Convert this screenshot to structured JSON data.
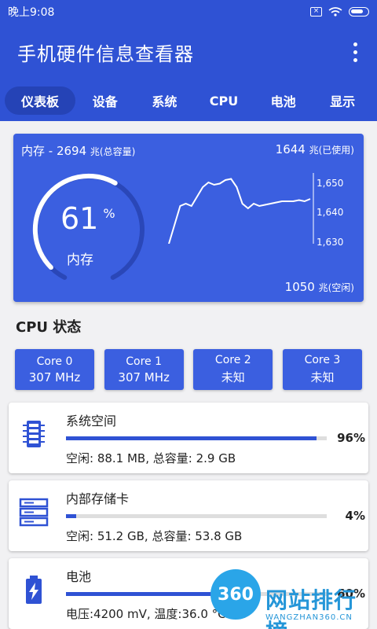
{
  "status_bar": {
    "time": "晚上9:08"
  },
  "app_bar": {
    "title": "手机硬件信息查看器"
  },
  "tabs": [
    {
      "label": "仪表板",
      "active": true
    },
    {
      "label": "设备"
    },
    {
      "label": "系统"
    },
    {
      "label": "CPU"
    },
    {
      "label": "电池"
    },
    {
      "label": "显示"
    }
  ],
  "memory": {
    "total_label": "内存 - 2694",
    "total_unit": "兆(总容量)",
    "used_value": "1644",
    "used_unit": "兆(已使用)",
    "free_value": "1050",
    "free_unit": "兆(空闲)",
    "gauge_percent": "61",
    "gauge_percent_sign": "%",
    "gauge_label": "内存",
    "gauge_fraction": 0.61
  },
  "chart_data": {
    "type": "line",
    "y_ticks": [
      "1,650",
      "1,640",
      "1,630"
    ],
    "ylim": [
      1625,
      1655
    ],
    "values": [
      1625,
      1633,
      1641,
      1642,
      1641,
      1645,
      1649,
      1651,
      1650,
      1650.5,
      1652,
      1652.5,
      1649,
      1642,
      1640,
      1642,
      1641,
      1641.5,
      1642,
      1642.5,
      1643,
      1643,
      1643,
      1643.5,
      1643,
      1644
    ]
  },
  "cpu_section": {
    "title": "CPU 状态"
  },
  "cores": [
    {
      "name": "Core 0",
      "freq": "307 MHz"
    },
    {
      "name": "Core 1",
      "freq": "307 MHz"
    },
    {
      "name": "Core 2",
      "freq": "未知"
    },
    {
      "name": "Core 3",
      "freq": "未知"
    }
  ],
  "storage": [
    {
      "name": "系统空间",
      "percent": "96%",
      "fraction": 0.96,
      "info": "空闲: 88.1 MB, 总容量: 2.9 GB",
      "icon": "ram-icon"
    },
    {
      "name": "内部存储卡",
      "percent": "4%",
      "fraction": 0.04,
      "info": "空闲: 51.2 GB, 总容量: 53.8 GB",
      "icon": "server-icon"
    },
    {
      "name": "电池",
      "percent": "60%",
      "fraction": 0.6,
      "info": "电压:4200 mV, 温度:36.0 °C",
      "icon": "battery-icon"
    }
  ],
  "watermark": {
    "badge": "360",
    "text": "网站排行榜",
    "url": "WANGZHAN360.CN"
  },
  "colors": {
    "primary": "#2f52d4",
    "card": "#3b5fe0",
    "bar_track": "#dedede"
  }
}
